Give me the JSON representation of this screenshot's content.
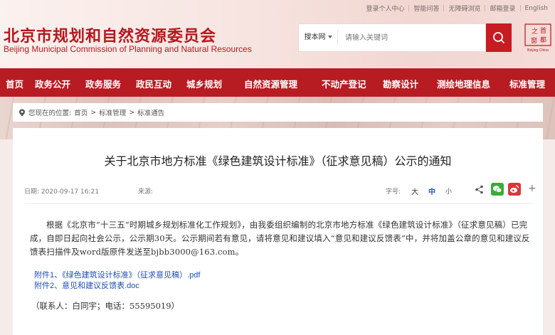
{
  "top_links": [
    "登录个人中心",
    "智能问答",
    "无障碍浏览",
    "邮箱登录",
    "English"
  ],
  "site": {
    "title": "北京市规划和自然资源委员会",
    "subtitle": "Beijing Municipal Commission of Planning and Natural Resources",
    "seal_text": "首都之窗",
    "seal_subtext": "Beijing·China"
  },
  "search": {
    "scope": "搜本网",
    "placeholder": "请输入关键词"
  },
  "nav": [
    "首页",
    "政务公开",
    "政务服务",
    "政民互动",
    "城乡规划",
    "自然资源管理",
    "不动产登记",
    "勘察设计",
    "测绘地理信息",
    "标准管理"
  ],
  "breadcrumb": {
    "prefix": "您现在的位置:",
    "items": [
      "首页",
      "标准管理",
      "标准通告"
    ],
    "separator": ">"
  },
  "article": {
    "title": "关于北京市地方标准《绿色建筑设计标准》（征求意见稿）公示的通知",
    "date": "日期: 2020-09-17 16:21",
    "source": "来源:",
    "font_size_label": "字号:",
    "font_big": "大",
    "font_mid": "中",
    "font_small": "小",
    "body": "根据《北京市“十三五”时期城乡规划标准化工作规划》，由我委组织编制的北京市地方标准《绿色建筑设计标准》（征求意见稿）已完成，自即日起向社会公示，公示期30天。公示期间若有意见，请将意见和建议填入“意见和建议反馈表”中，并将加盖公章的意见和建议反馈表扫描件及word版原件发送至bjbb3000@163.com。",
    "attachments": [
      "附件1、《绿色建筑设计标准》（征求意见稿）.pdf",
      "附件2、意见和建议反馈表.doc"
    ],
    "contact": "（联系人：白同宇；电话：55595019）"
  },
  "colors": {
    "brand_red": "#b71c22",
    "link_blue": "#1f4fb4"
  }
}
